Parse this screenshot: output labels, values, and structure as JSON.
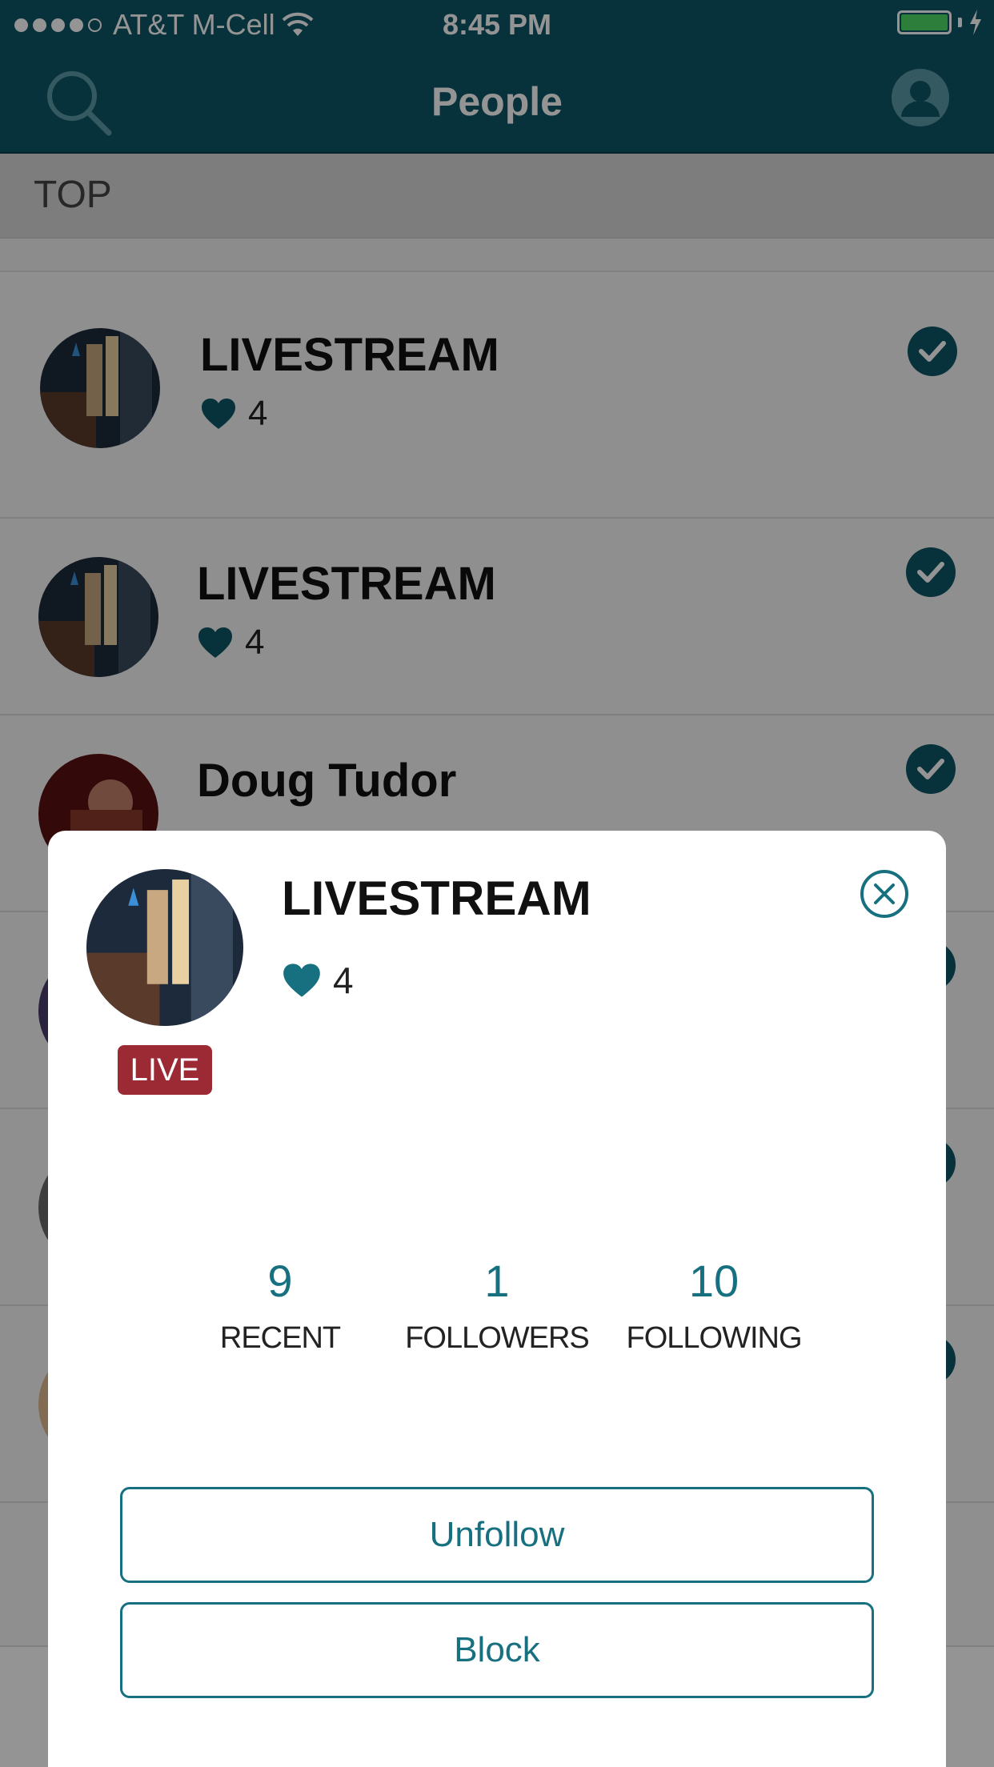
{
  "status_bar": {
    "carrier": "AT&T M-Cell",
    "time": "8:45 PM",
    "signal_bars_filled": 4,
    "signal_bars_total": 5
  },
  "nav": {
    "title": "People",
    "left_icon": "search-icon",
    "right_icon": "profile-icon"
  },
  "section": {
    "title": "TOP"
  },
  "list": {
    "items": [
      {
        "name": "LIVESTREAM",
        "likes": "4",
        "checked": true
      },
      {
        "name": "LIVESTREAM",
        "likes": "4",
        "checked": true
      },
      {
        "name": "Doug Tudor",
        "likes": "",
        "checked": true
      }
    ]
  },
  "modal": {
    "name": "LIVESTREAM",
    "likes": "4",
    "badge": "LIVE",
    "stats": [
      {
        "value": "9",
        "label": "RECENT"
      },
      {
        "value": "1",
        "label": "FOLLOWERS"
      },
      {
        "value": "10",
        "label": "FOLLOWING"
      }
    ],
    "unfollow_label": "Unfollow",
    "block_label": "Block"
  },
  "colors": {
    "brand": "#0f5666",
    "accent": "#16707f",
    "live_badge": "#9c2a35"
  }
}
